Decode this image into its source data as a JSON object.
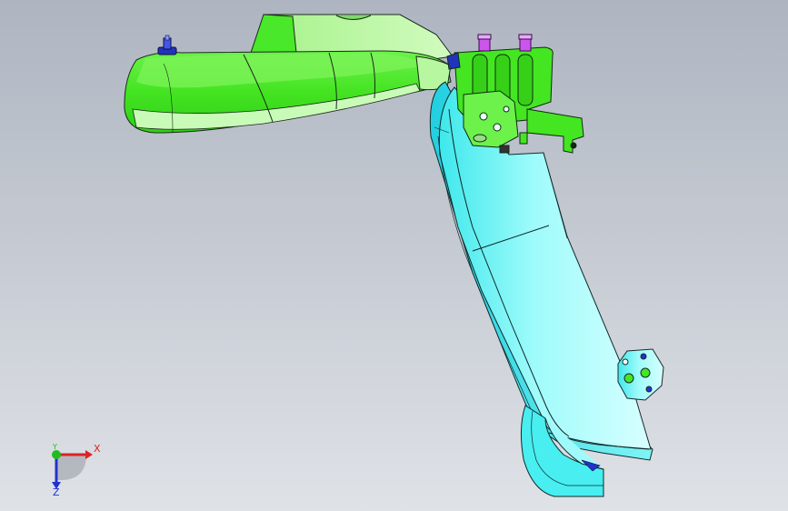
{
  "viewport": {
    "background_top": "#aeb5c1",
    "background_bottom": "#dfe2e7"
  },
  "model": {
    "colors": {
      "green_part": "#44ee22",
      "light_green_part": "#b4f59a",
      "cyan_part": "#7ff7f7",
      "bracket": "#33dd33",
      "fastener_blue": "#3344dd",
      "fastener_magenta": "#cc55ee",
      "edge": "#1a2a1a"
    }
  },
  "triad": {
    "x_label": "X",
    "y_label": "Y",
    "z_label": "Z",
    "x_color": "#dd2222",
    "y_color": "#22bb22",
    "z_color": "#2233cc"
  }
}
